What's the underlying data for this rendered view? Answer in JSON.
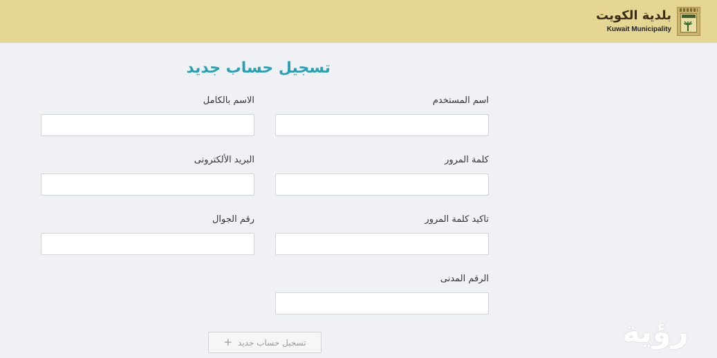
{
  "header": {
    "brand_ar": "بلدية الكويت",
    "brand_en": "Kuwait Municipality",
    "logo_icon": "kuwait-municipality-emblem"
  },
  "form": {
    "title": "تسجيل حساب جديد",
    "fields": {
      "username": {
        "label": "اسم المستخدم",
        "value": "",
        "placeholder": ""
      },
      "full_name": {
        "label": "الاسم بالكامل",
        "value": "",
        "placeholder": ""
      },
      "password": {
        "label": "كلمة المرور",
        "value": "",
        "placeholder": ""
      },
      "email": {
        "label": "البريد الألكترونى",
        "value": "",
        "placeholder": ""
      },
      "confirm_password": {
        "label": "تاكيد كلمة المرور",
        "value": "",
        "placeholder": ""
      },
      "mobile": {
        "label": "رقم الجوال",
        "value": "",
        "placeholder": ""
      },
      "civil_id": {
        "label": "الرقم المدنى",
        "value": "",
        "placeholder": ""
      }
    },
    "submit": {
      "label": "تسجيل حساب جديد",
      "icon": "plus-icon",
      "glyph": "+"
    }
  },
  "watermark": {
    "text": "رؤية"
  },
  "colors": {
    "header_bg": "#e5d793",
    "page_bg": "#f0f1f5",
    "title": "#2aa0b4"
  }
}
